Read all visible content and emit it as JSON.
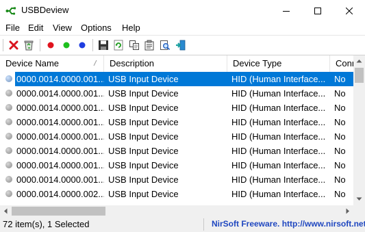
{
  "window": {
    "title": "USBDeview",
    "app_icon": "usb-plug-icon",
    "controls": [
      "minimize-icon",
      "maximize-icon",
      "close-icon"
    ]
  },
  "menu": [
    "File",
    "Edit",
    "View",
    "Options",
    "Help"
  ],
  "toolbar": {
    "buttons": [
      {
        "name": "disconnect-button",
        "icon": "red-x-icon"
      },
      {
        "name": "uninstall-button",
        "icon": "recycle-bin-icon"
      },
      {
        "name": "red-status-button",
        "icon": "red-dot-icon"
      },
      {
        "name": "green-status-button",
        "icon": "green-dot-icon"
      },
      {
        "name": "blue-status-button",
        "icon": "blue-dot-icon"
      },
      {
        "name": "save-button",
        "icon": "floppy-disk-icon"
      },
      {
        "name": "refresh-button",
        "icon": "refresh-icon"
      },
      {
        "name": "copy-button",
        "icon": "copy-icon"
      },
      {
        "name": "properties-button",
        "icon": "properties-icon"
      },
      {
        "name": "find-button",
        "icon": "find-icon"
      },
      {
        "name": "exit-button",
        "icon": "exit-door-icon"
      }
    ],
    "colors": {
      "red": "#e0141e",
      "green": "#1fbf1f",
      "blue": "#1f3ee0"
    }
  },
  "table": {
    "columns": [
      "Device Name",
      "Description",
      "Device Type",
      "Conn"
    ],
    "sorted_column": "Device Name",
    "rows": [
      {
        "device_name": "0000.0014.0000.001....",
        "description": "USB Input Device",
        "device_type": "HID (Human Interface...",
        "connected": "No",
        "selected": true
      },
      {
        "device_name": "0000.0014.0000.001....",
        "description": "USB Input Device",
        "device_type": "HID (Human Interface...",
        "connected": "No",
        "selected": false
      },
      {
        "device_name": "0000.0014.0000.001....",
        "description": "USB Input Device",
        "device_type": "HID (Human Interface...",
        "connected": "No",
        "selected": false
      },
      {
        "device_name": "0000.0014.0000.001....",
        "description": "USB Input Device",
        "device_type": "HID (Human Interface...",
        "connected": "No",
        "selected": false
      },
      {
        "device_name": "0000.0014.0000.001....",
        "description": "USB Input Device",
        "device_type": "HID (Human Interface...",
        "connected": "No",
        "selected": false
      },
      {
        "device_name": "0000.0014.0000.001....",
        "description": "USB Input Device",
        "device_type": "HID (Human Interface...",
        "connected": "No",
        "selected": false
      },
      {
        "device_name": "0000.0014.0000.001....",
        "description": "USB Input Device",
        "device_type": "HID (Human Interface...",
        "connected": "No",
        "selected": false
      },
      {
        "device_name": "0000.0014.0000.001....",
        "description": "USB Input Device",
        "device_type": "HID (Human Interface...",
        "connected": "No",
        "selected": false
      },
      {
        "device_name": "0000.0014.0000.002....",
        "description": "USB Input Device",
        "device_type": "HID (Human Interface...",
        "connected": "No",
        "selected": false
      }
    ],
    "row_icon": "gray-status-dot-icon",
    "selection_color": "#0078d7"
  },
  "status": {
    "items": "72 item(s), 1 Selected",
    "credit": "NirSoft Freeware.  http://www.nirsoft.net",
    "credit_color": "#1f47c0"
  }
}
